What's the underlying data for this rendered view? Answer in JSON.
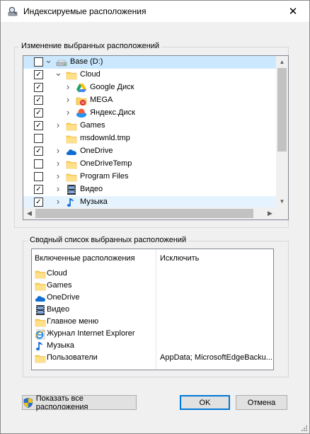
{
  "window": {
    "title": "Индексируемые расположения",
    "close_glyph": "✕"
  },
  "change_group": {
    "label": "Изменение выбранных расположений",
    "tree": [
      {
        "label": "Base (D:)",
        "checked": false,
        "expander": "expanded",
        "icon": "drive-icon",
        "selected": true
      },
      {
        "label": "Cloud",
        "checked": true,
        "expander": "expanded",
        "icon": "folder-icon"
      },
      {
        "label": "Google Диск",
        "checked": true,
        "expander": "collapsed",
        "icon": "google-drive-icon"
      },
      {
        "label": "MEGA",
        "checked": true,
        "expander": "collapsed",
        "icon": "mega-icon"
      },
      {
        "label": "Яндекс.Диск",
        "checked": true,
        "expander": "collapsed",
        "icon": "yandex-disk-icon"
      },
      {
        "label": "Games",
        "checked": true,
        "expander": "collapsed",
        "icon": "folder-icon"
      },
      {
        "label": "msdownld.tmp",
        "checked": false,
        "expander": "none",
        "icon": "folder-icon"
      },
      {
        "label": "OneDrive",
        "checked": true,
        "expander": "collapsed",
        "icon": "onedrive-icon"
      },
      {
        "label": "OneDriveTemp",
        "checked": false,
        "expander": "collapsed",
        "icon": "folder-icon"
      },
      {
        "label": "Program Files",
        "checked": false,
        "expander": "collapsed",
        "icon": "folder-icon"
      },
      {
        "label": "Видео",
        "checked": true,
        "expander": "collapsed",
        "icon": "video-icon"
      },
      {
        "label": "Музыка",
        "checked": true,
        "expander": "collapsed",
        "icon": "music-icon",
        "hover": true
      }
    ]
  },
  "summary_group": {
    "label": "Сводный список выбранных расположений",
    "col_included": "Включенные расположения",
    "col_exclude": "Исключить",
    "rows": [
      {
        "label": "Cloud",
        "icon": "folder-icon",
        "exclude": ""
      },
      {
        "label": "Games",
        "icon": "folder-icon",
        "exclude": ""
      },
      {
        "label": "OneDrive",
        "icon": "onedrive-icon",
        "exclude": ""
      },
      {
        "label": "Видео",
        "icon": "video-icon",
        "exclude": ""
      },
      {
        "label": "Главное меню",
        "icon": "folder-icon",
        "exclude": ""
      },
      {
        "label": "Журнал Internet Explorer",
        "icon": "ie-icon",
        "exclude": ""
      },
      {
        "label": "Музыка",
        "icon": "music-icon",
        "exclude": ""
      },
      {
        "label": "Пользователи",
        "icon": "folder-icon",
        "exclude": "AppData; MicrosoftEdgeBacku..."
      }
    ]
  },
  "buttons": {
    "show_all": "Показать все расположения",
    "ok": "OK",
    "cancel": "Отмена"
  }
}
